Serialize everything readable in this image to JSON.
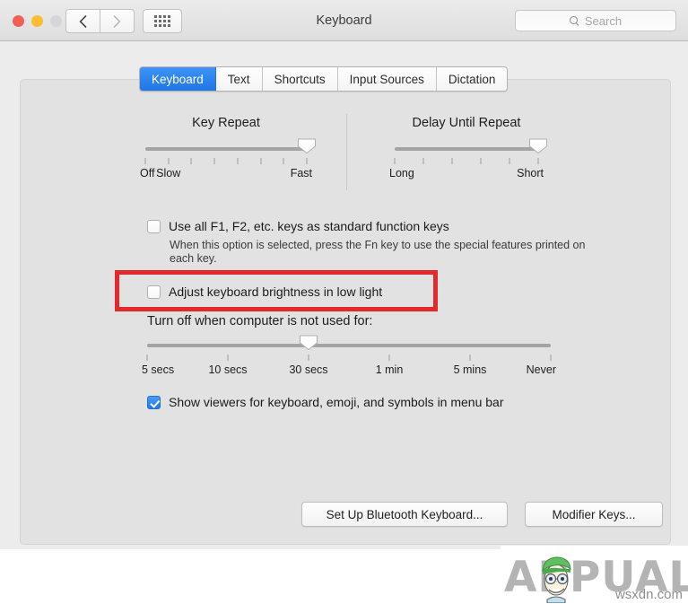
{
  "window": {
    "title": "Keyboard",
    "traffic_lights": [
      "close-red",
      "minimize-yellow",
      "zoom-disabled-gray"
    ],
    "back_icon": "chevron-left-icon",
    "forward_icon": "chevron-right-icon",
    "grid_icon": "show-all-grid-icon",
    "search": {
      "icon": "search-icon",
      "placeholder": "Search",
      "value": ""
    }
  },
  "tabs": [
    {
      "label": "Keyboard",
      "active": true
    },
    {
      "label": "Text",
      "active": false
    },
    {
      "label": "Shortcuts",
      "active": false
    },
    {
      "label": "Input Sources",
      "active": false
    },
    {
      "label": "Dictation",
      "active": false
    }
  ],
  "sliders": {
    "key_repeat": {
      "title": "Key Repeat",
      "tick_count": 8,
      "value_index": 7,
      "labels": [
        {
          "text": "Off",
          "tick": 0
        },
        {
          "text": "Slow",
          "tick": 1
        },
        {
          "text": "Fast",
          "tick": 7
        }
      ]
    },
    "delay_until_repeat": {
      "title": "Delay Until Repeat",
      "tick_count": 6,
      "value_index": 5,
      "labels": [
        {
          "text": "Long",
          "tick": 0
        },
        {
          "text": "Short",
          "tick": 5
        }
      ]
    },
    "turn_off": {
      "title": "Turn off when computer is not used for:",
      "tick_count": 6,
      "value_index": 2,
      "labels": [
        {
          "text": "5 secs",
          "tick": 0
        },
        {
          "text": "10 secs",
          "tick": 1
        },
        {
          "text": "30 secs",
          "tick": 2
        },
        {
          "text": "1 min",
          "tick": 3
        },
        {
          "text": "5 mins",
          "tick": 4
        },
        {
          "text": "Never",
          "tick": 5
        }
      ]
    }
  },
  "checkboxes": {
    "function_keys": {
      "label": "Use all F1, F2, etc. keys as standard function keys",
      "checked": false,
      "help": "When this option is selected, press the Fn key to use the special features printed on each key."
    },
    "adjust_brightness": {
      "label": "Adjust keyboard brightness in low light",
      "checked": false
    },
    "show_viewers": {
      "label": "Show viewers for keyboard, emoji, and symbols in menu bar",
      "checked": true
    }
  },
  "buttons": {
    "bluetooth": "Set Up Bluetooth Keyboard...",
    "modifier": "Modifier Keys..."
  },
  "annotation": {
    "highlight_color": "#e5282a",
    "target": "adjust-keyboard-brightness-row"
  },
  "watermark": {
    "brand": "APPUALS",
    "site": "wsxdn.com"
  }
}
